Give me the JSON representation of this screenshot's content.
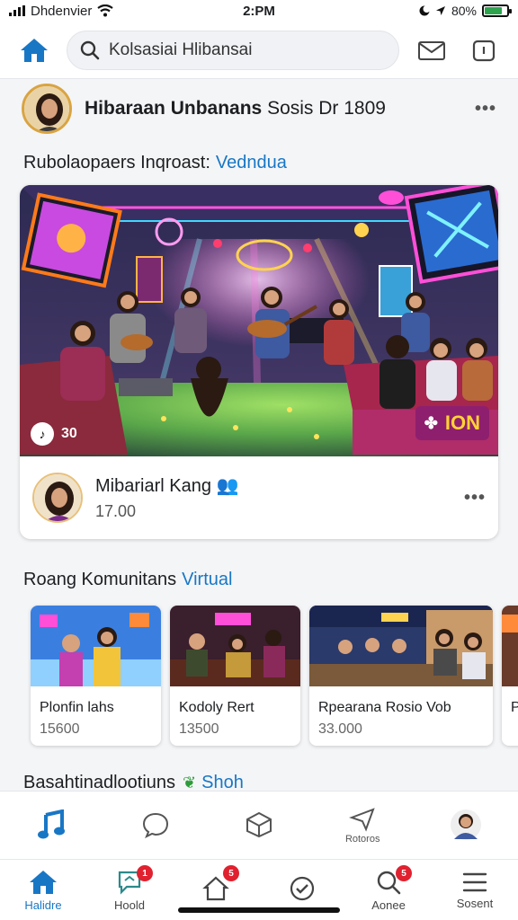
{
  "status_bar": {
    "carrier": "Dhdenvier",
    "time": "2:PM",
    "battery": "80%",
    "battery_level": 0.8
  },
  "top_bar": {
    "search_placeholder": "Kolsasiai Hlibansai",
    "home_icon": "home-icon",
    "mail_badge": "",
    "inbox_badge": ""
  },
  "post": {
    "title_bold": "Hibaraan Unbanans",
    "title_rest": "Sosis Dr 1809"
  },
  "section1": {
    "title": "Rubolaopaers Inqroast:",
    "accent": "Vedndua"
  },
  "hero": {
    "play_count": "30",
    "logo_text": "ION"
  },
  "featured": {
    "name": "Mibariarl Kang",
    "count": "17.00"
  },
  "section2": {
    "title": "Roang Komunitans",
    "accent": "Virtual",
    "items": [
      {
        "name": "Plonfin lahs",
        "count": "15600"
      },
      {
        "name": "Kodoly Rert",
        "count": "13500"
      },
      {
        "name": "Rpearana Rosio Vob",
        "count": "33.000"
      },
      {
        "name": "P",
        "count": ""
      }
    ]
  },
  "section3": {
    "title": "Basahtinadlootiuns",
    "accent": "Shoh"
  },
  "subnav": [
    {
      "icon": "music-note-icon",
      "label": ""
    },
    {
      "icon": "chat-bubble-icon",
      "label": ""
    },
    {
      "icon": "cube-icon",
      "label": ""
    },
    {
      "icon": "send-icon",
      "label": "Rotoros"
    },
    {
      "icon": "profile-avatar-icon",
      "label": ""
    }
  ],
  "mainnav": [
    {
      "icon": "home-icon",
      "label": "Halidre",
      "badge": ""
    },
    {
      "icon": "chat-icon",
      "label": "Hoold",
      "badge": "1"
    },
    {
      "icon": "house-outline-icon",
      "label": "",
      "badge": "5"
    },
    {
      "icon": "check-circle-icon",
      "label": "",
      "badge": ""
    },
    {
      "icon": "search-icon",
      "label": "Aonee",
      "badge": "5"
    },
    {
      "icon": "menu-icon",
      "label": "Sosent",
      "badge": ""
    }
  ],
  "colors": {
    "accent": "#1877c5",
    "badge": "#e0212f",
    "logo_bg": "#8e1f6e",
    "logo_text": "#ffd233"
  }
}
